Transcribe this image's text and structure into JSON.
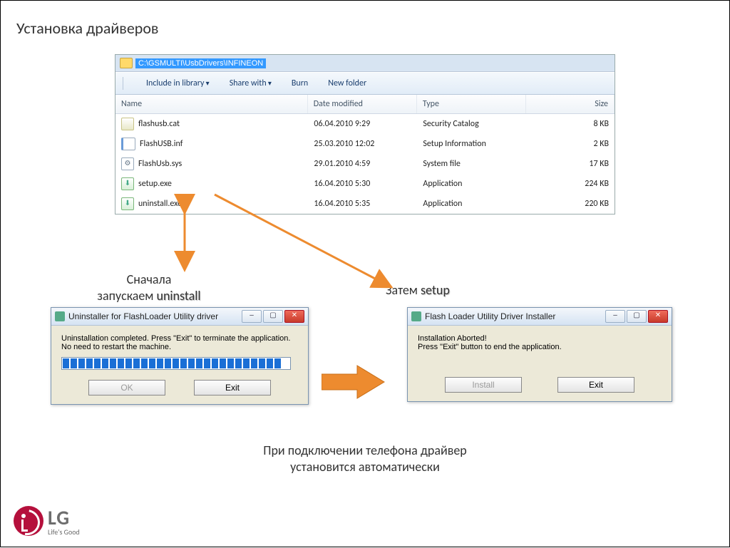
{
  "title": "Установка драйверов",
  "explorer": {
    "path": "C:\\GSMULTI\\UsbDrivers\\INFINEON",
    "toolbar": {
      "include": "Include in library",
      "share": "Share with",
      "burn": "Burn",
      "newfolder": "New folder"
    },
    "columns": {
      "name": "Name",
      "date": "Date modified",
      "type": "Type",
      "size": "Size"
    },
    "files": [
      {
        "icon": "ic-cat",
        "name": "flashusb.cat",
        "date": "06.04.2010 9:29",
        "type": "Security Catalog",
        "size": "8 KB"
      },
      {
        "icon": "ic-inf",
        "name": "FlashUSB.inf",
        "date": "25.03.2010 12:02",
        "type": "Setup Information",
        "size": "2 KB"
      },
      {
        "icon": "ic-sys",
        "name": "FlashUsb.sys",
        "date": "29.01.2010 4:59",
        "type": "System file",
        "size": "17 KB"
      },
      {
        "icon": "ic-exe",
        "name": "setup.exe",
        "date": "16.04.2010 5:30",
        "type": "Application",
        "size": "224 KB"
      },
      {
        "icon": "ic-exe",
        "name": "uninstall.exe",
        "date": "16.04.2010 5:35",
        "type": "Application",
        "size": "220 KB"
      }
    ]
  },
  "annot": {
    "left1": "Сначала",
    "left2": "запускаем ",
    "left_b": "uninstall",
    "right1": "Затем ",
    "right_b": "setup"
  },
  "dlg_un": {
    "title": "Uninstaller for FlashLoader Utility driver",
    "line1": "Uninstallation completed. Press \"Exit\" to terminate the application.",
    "line2": " No need to restart the machine.",
    "ok": "OK",
    "exit": "Exit"
  },
  "dlg_in": {
    "title": "Flash Loader Utility Driver Installer",
    "line1": "Installation Aborted!",
    "line2": "Press \"Exit\" button to end the application.",
    "install": "Install",
    "exit": "Exit"
  },
  "footer1": "При подключении телефона драйвер",
  "footer2": "установится автоматически",
  "logo": {
    "brand": "LG",
    "tagline": "Life's Good"
  }
}
